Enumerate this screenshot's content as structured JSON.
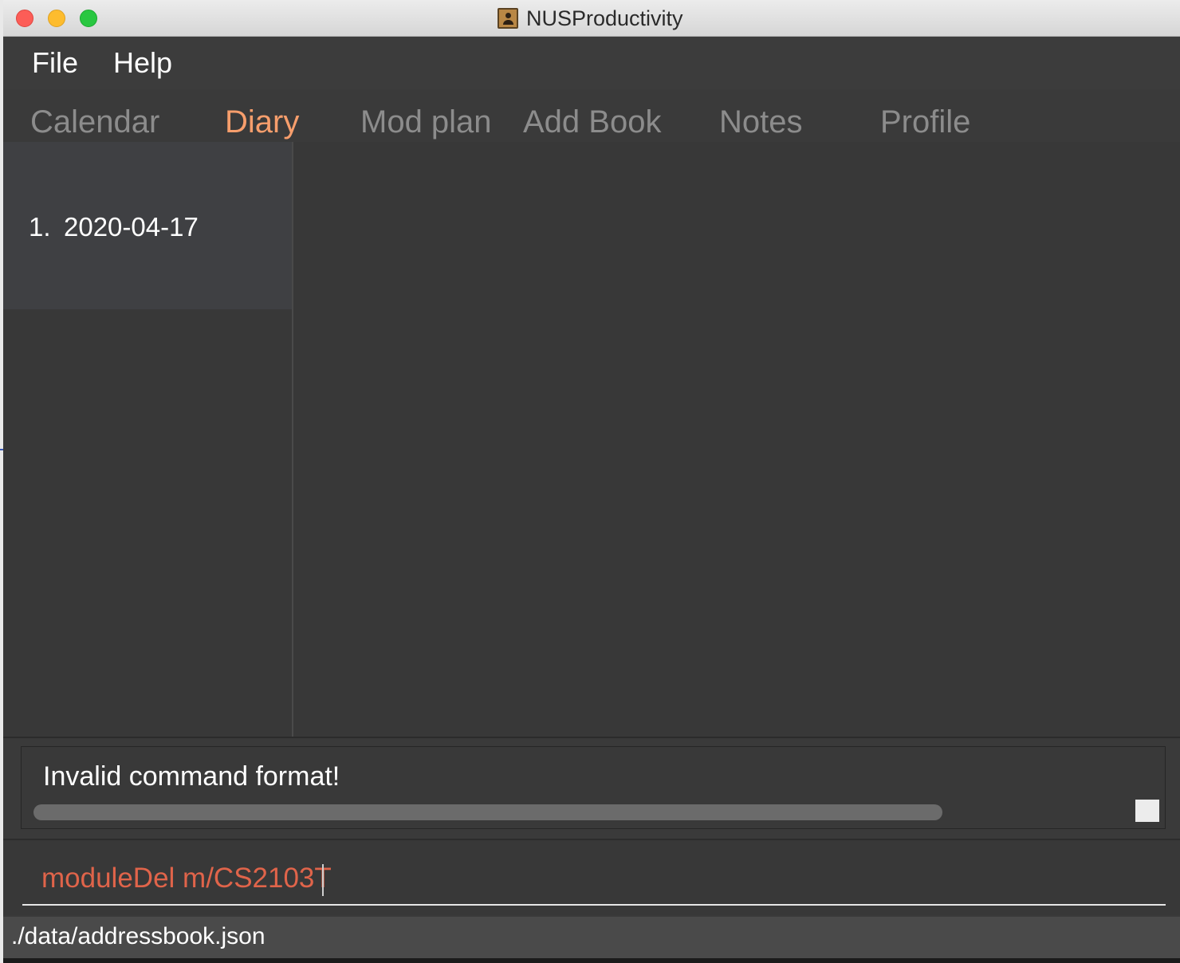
{
  "window": {
    "title": "NUSProductivity",
    "app_icon": "contacts-book-icon"
  },
  "menu": {
    "items": [
      {
        "label": "File"
      },
      {
        "label": "Help"
      }
    ]
  },
  "tabs": {
    "items": [
      {
        "label": "Calendar",
        "active": false
      },
      {
        "label": "Diary",
        "active": true
      },
      {
        "label": "Mod plan",
        "active": false
      },
      {
        "label": "Add Book",
        "active": false
      },
      {
        "label": "Notes",
        "active": false
      },
      {
        "label": "Profile",
        "active": false
      }
    ],
    "active_color": "#f79e6c",
    "inactive_color": "#8c8c8c"
  },
  "diary_list": {
    "items": [
      {
        "index": "1.",
        "date": "2020-04-17"
      }
    ]
  },
  "result_display": {
    "text": "Invalid command format!"
  },
  "command_box": {
    "value": "moduleDel m/CS2103T",
    "text_color": "#e0644a"
  },
  "status_bar": {
    "path": "./data/addressbook.json"
  }
}
